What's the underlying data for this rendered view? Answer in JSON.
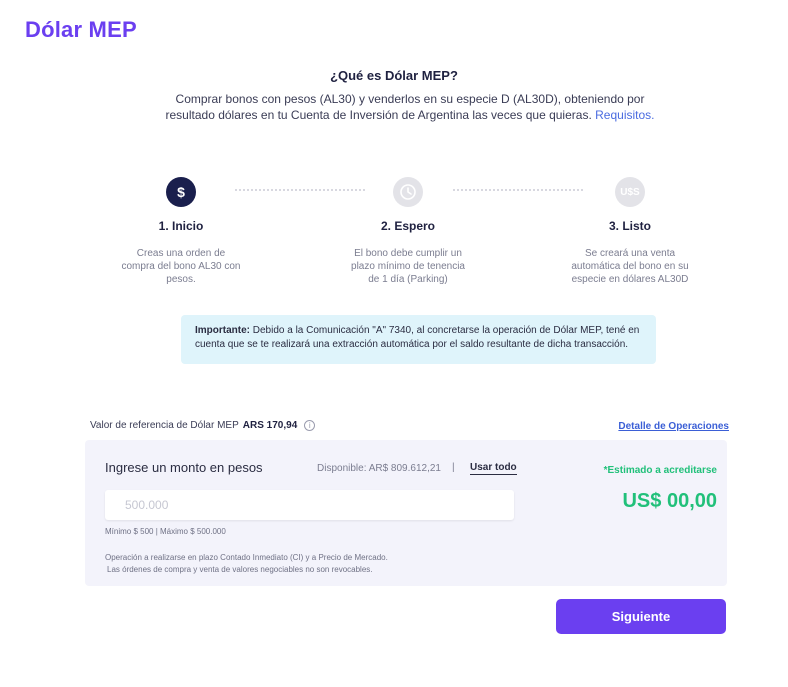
{
  "header": {
    "title": "Dólar MEP"
  },
  "intro": {
    "title": "¿Qué es Dólar MEP?",
    "description": "Comprar bonos con pesos (AL30) y venderlos en su especie D (AL30D), obteniendo por resultado dólares en tu Cuenta de Inversión de Argentina las veces que quieras.",
    "link": "Requisitos."
  },
  "steps": [
    {
      "icon": "dollar-icon",
      "glyph": "$",
      "title": "1. Inicio",
      "description": "Creas una orden de compra del bono AL30 con pesos.",
      "state": "active"
    },
    {
      "icon": "clock-icon",
      "glyph": "◷",
      "title": "2. Espero",
      "description": "El bono debe cumplir un plazo mínimo de tenencia de 1 día (Parking)",
      "state": "inactive"
    },
    {
      "icon": "usd-icon",
      "glyph": "U$S",
      "title": "3. Listo",
      "description": "Se creará una venta automática del bono en su especie en dólares AL30D",
      "state": "inactive"
    }
  ],
  "notice": {
    "bold": "Importante:",
    "text": " Debido a la Comunicación \"A\" 7340, al concretarse la operación de Dólar MEP, tené en cuenta que se te realizará una extracción automática por el saldo resultante de dicha transacción."
  },
  "reference": {
    "label": "Valor de referencia de Dólar MEP",
    "value": "ARS 170,94",
    "info_glyph": "i"
  },
  "detail_link": "Detalle de Operaciones",
  "form": {
    "label": "Ingrese un monto en pesos",
    "available": "Disponible: AR$ 809.612,21",
    "separator": "|",
    "use_all": "Usar todo",
    "input_value": "",
    "input_placeholder": "500.000",
    "limits": "Mínimo $ 500 | Máximo $ 500.000",
    "footnote_line1": "Operación a realizarse en plazo Contado Inmediato (CI) y a Precio de Mercado.",
    "footnote_line2": "Las órdenes de compra y venta de valores negociables no son revocables.",
    "estimate_label": "*Estimado a acreditarse",
    "estimate_value": "US$ 00,00"
  },
  "next_button": "Siguiente",
  "colors": {
    "brand": "#6b3ff0",
    "success": "#21c07a",
    "link": "#3b5fd6",
    "notice_bg": "#dff4fb",
    "step_active": "#1a1f4d"
  }
}
